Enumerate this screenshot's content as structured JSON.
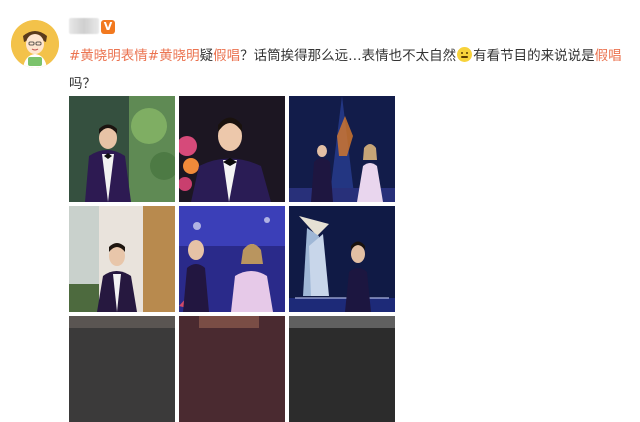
{
  "post": {
    "verified_badge": "V",
    "text_parts": {
      "hashtag1": "#黄晓明表情#",
      "name": "黄晓明",
      "mid1": "疑",
      "lipsync1": "假唱",
      "mid2": "？话筒挨得那么远…表情也不太自然",
      "mid3": "有看节目的来说说是",
      "lipsync2": "假唱",
      "end": "吗？"
    }
  },
  "photos": {
    "count": 9
  },
  "colors": {
    "accent": "#eb7350",
    "text": "#333333",
    "avatar_bg": "#f3c24a"
  }
}
